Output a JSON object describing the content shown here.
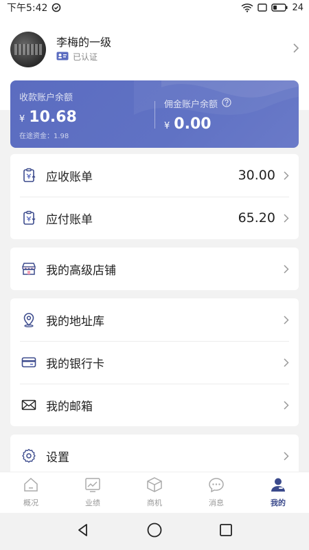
{
  "status_bar": {
    "time": "下午5:42",
    "battery": "24"
  },
  "profile": {
    "name": "李梅的一级",
    "verify_label": "已认证"
  },
  "balance": {
    "receive_title": "收款账户余额",
    "receive_currency": "¥",
    "receive_amount": "10.68",
    "in_transit_label": "在途资金：1.98",
    "commission_title": "佣金账户余额",
    "commission_currency": "¥",
    "commission_amount": "0.00"
  },
  "bills": [
    {
      "label": "应收账单",
      "value": "30.00"
    },
    {
      "label": "应付账单",
      "value": "65.20"
    }
  ],
  "store": {
    "label": "我的高级店铺"
  },
  "menu": [
    {
      "label": "我的地址库"
    },
    {
      "label": "我的银行卡"
    },
    {
      "label": "我的邮箱"
    }
  ],
  "settings": {
    "label": "设置"
  },
  "tabs": [
    {
      "label": "概况",
      "icon": "home-icon"
    },
    {
      "label": "业绩",
      "icon": "chart-icon"
    },
    {
      "label": "商机",
      "icon": "box-icon"
    },
    {
      "label": "消息",
      "icon": "message-icon"
    },
    {
      "label": "我的",
      "icon": "user-icon"
    }
  ],
  "colors": {
    "accent": "#5b6cc0",
    "tab_active": "#3b4a8c"
  }
}
